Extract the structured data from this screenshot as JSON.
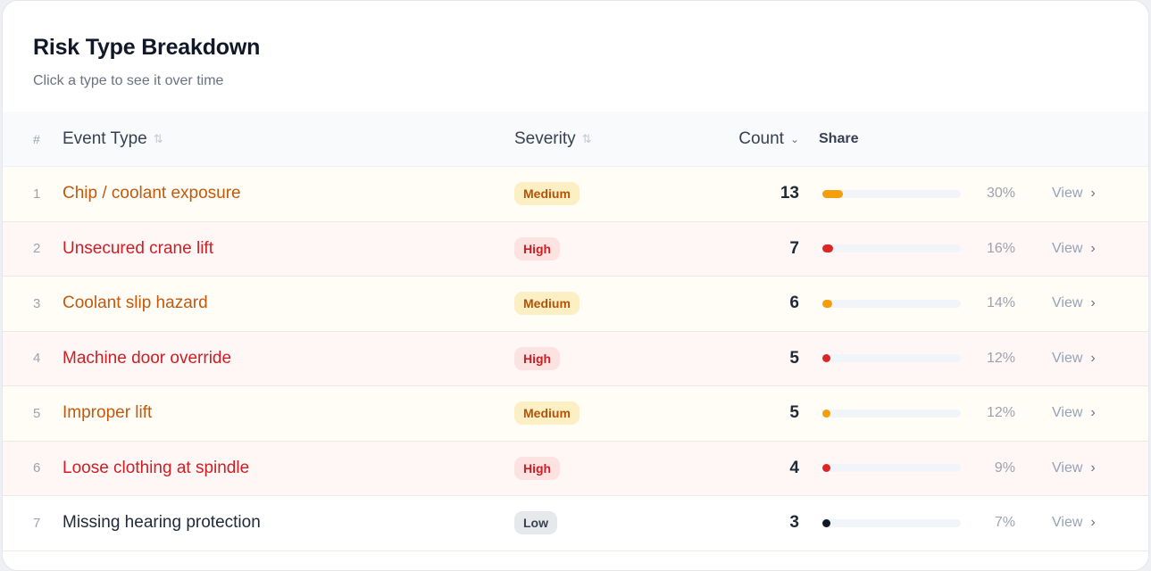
{
  "card": {
    "title": "Risk Type Breakdown",
    "subtitle": "Click a type to see it over time"
  },
  "columns": {
    "num": "#",
    "type": "Event Type",
    "severity": "Severity",
    "count": "Count",
    "share": "Share"
  },
  "icons": {
    "sort": "sort-arrows-icon",
    "sort_desc": "chevron-down-icon",
    "view": "chevron-right-icon"
  },
  "colors": {
    "medium": "#f59e0b",
    "high": "#dc2626",
    "low": "#0f172a"
  },
  "rows": [
    {
      "num": "1",
      "type": "Chip / coolant exposure",
      "severity": "Medium",
      "level": "medium",
      "count": "13",
      "share": 0.3,
      "pct": "30%",
      "view": "View"
    },
    {
      "num": "2",
      "type": "Unsecured crane lift",
      "severity": "High",
      "level": "high",
      "count": "7",
      "share": 0.16,
      "pct": "16%",
      "view": "View"
    },
    {
      "num": "3",
      "type": "Coolant slip hazard",
      "severity": "Medium",
      "level": "medium",
      "count": "6",
      "share": 0.14,
      "pct": "14%",
      "view": "View"
    },
    {
      "num": "4",
      "type": "Machine door override",
      "severity": "High",
      "level": "high",
      "count": "5",
      "share": 0.12,
      "pct": "12%",
      "view": "View"
    },
    {
      "num": "5",
      "type": "Improper lift",
      "severity": "Medium",
      "level": "medium",
      "count": "5",
      "share": 0.12,
      "pct": "12%",
      "view": "View"
    },
    {
      "num": "6",
      "type": "Loose clothing at spindle",
      "severity": "High",
      "level": "high",
      "count": "4",
      "share": 0.09,
      "pct": "9%",
      "view": "View"
    },
    {
      "num": "7",
      "type": "Missing hearing protection",
      "severity": "Low",
      "level": "low",
      "count": "3",
      "share": 0.07,
      "pct": "7%",
      "view": "View"
    }
  ]
}
